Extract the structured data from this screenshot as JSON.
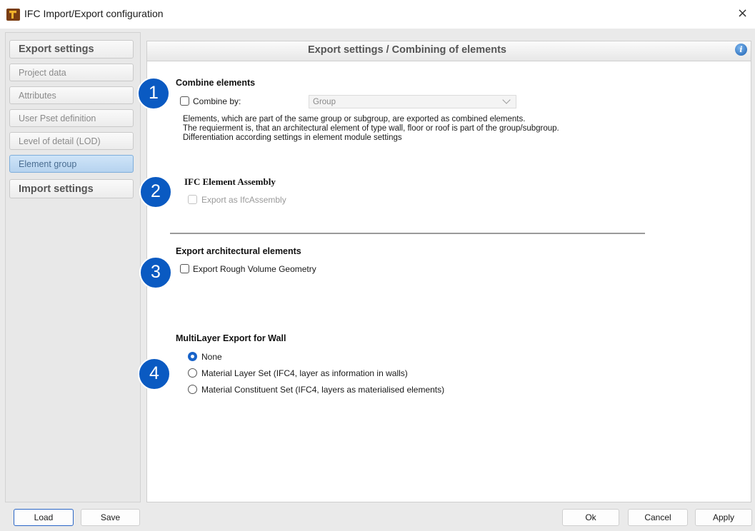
{
  "window": {
    "title": "IFC Import/Export configuration",
    "close": "×"
  },
  "sidebar": {
    "items": [
      {
        "label": "Export settings",
        "type": "header"
      },
      {
        "label": "Project data"
      },
      {
        "label": "Attributes"
      },
      {
        "label": "User Pset definition"
      },
      {
        "label": "Level of detail (LOD)"
      },
      {
        "label": "Element group",
        "active": true
      },
      {
        "label": "Import settings",
        "type": "header"
      }
    ]
  },
  "panel": {
    "title": "Export settings / Combining of elements",
    "info_icon": "i"
  },
  "badges": [
    "1",
    "2",
    "3",
    "4"
  ],
  "combine": {
    "title": "Combine elements",
    "checkbox_label": "Combine by:",
    "checked": false,
    "select_value": "Group",
    "description": [
      "Elements, which are part of the same group or subgroup, are exported  as combined elements.",
      "The requierment is, that an architectural element of type wall, floor or roof is part of the group/subgroup.",
      "Differentiation according settings in element module settings"
    ]
  },
  "assembly": {
    "title": "IFC Element Assembly",
    "checkbox_label": "Export as IfcAssembly",
    "enabled": false
  },
  "architectural": {
    "title": "Export architectural elements",
    "checkbox_label": "Export Rough Volume Geometry",
    "checked": false
  },
  "multilayer": {
    "title": "MultiLayer Export for Wall",
    "options": [
      {
        "label": "None",
        "selected": true
      },
      {
        "label": "Material Layer Set (IFC4, layer as information in walls)",
        "selected": false
      },
      {
        "label": "Material Constituent Set (IFC4, layers as materialised elements)",
        "selected": false
      }
    ]
  },
  "footer": {
    "load": "Load",
    "save": "Save",
    "ok": "Ok",
    "cancel": "Cancel",
    "apply": "Apply"
  },
  "colors": {
    "badge": "#0a5ac2",
    "active_nav": "#b6d3ef",
    "radio_checked": "#1863c9"
  }
}
